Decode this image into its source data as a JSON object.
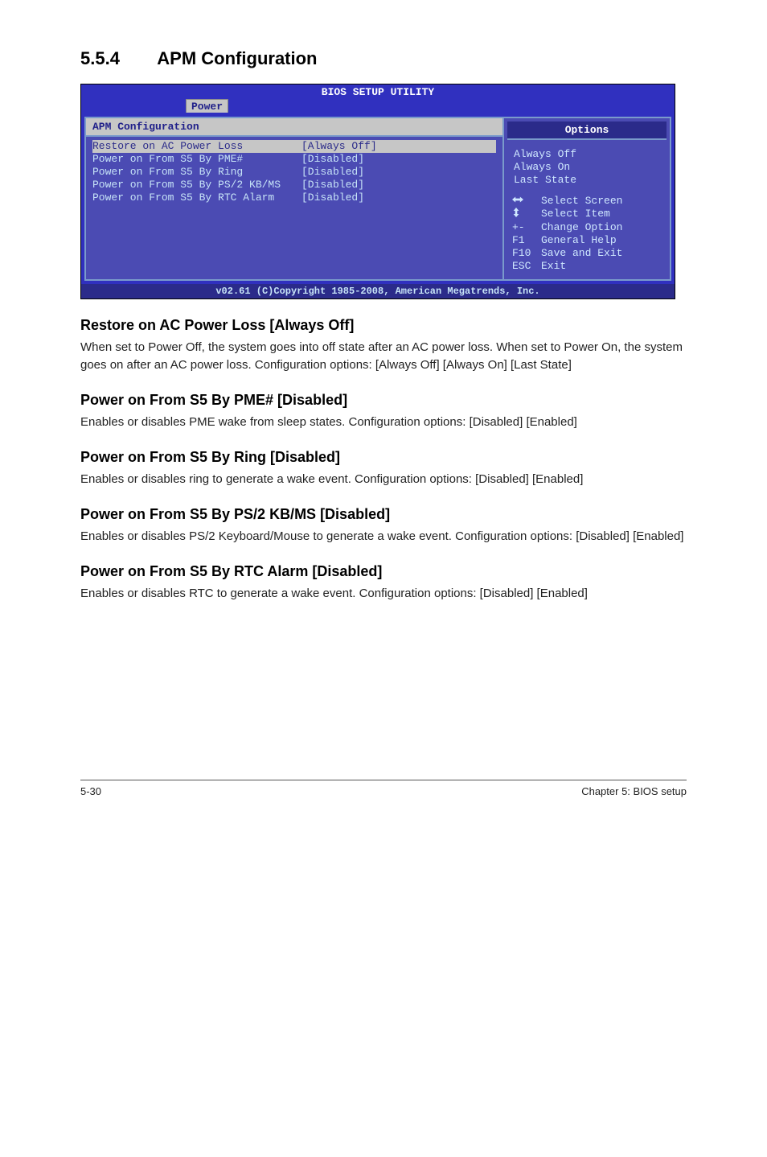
{
  "section": {
    "number": "5.5.4",
    "title": "APM Configuration"
  },
  "bios": {
    "utility_title": "BIOS SETUP UTILITY",
    "tab": "Power",
    "panel_title": "APM Configuration",
    "settings": [
      {
        "label": "Restore on AC Power Loss",
        "value": "[Always Off]",
        "selected": true
      },
      {
        "label": "Power on From S5 By PME#",
        "value": "[Disabled]",
        "selected": false
      },
      {
        "label": "Power on From S5 By Ring",
        "value": "[Disabled]",
        "selected": false
      },
      {
        "label": "Power on From S5 By PS/2 KB/MS",
        "value": "[Disabled]",
        "selected": false
      },
      {
        "label": "Power on From S5 By RTC Alarm",
        "value": "[Disabled]",
        "selected": false
      }
    ],
    "options_header": "Options",
    "options": [
      "Always Off",
      "Always On",
      "Last State"
    ],
    "help": [
      {
        "key": "↔",
        "text": "Select Screen",
        "icon": "lr-arrows-icon"
      },
      {
        "key": "↕",
        "text": "Select Item",
        "icon": "ud-arrows-icon"
      },
      {
        "key": "+-",
        "text": "Change Option",
        "icon": ""
      },
      {
        "key": "F1",
        "text": "General Help",
        "icon": ""
      },
      {
        "key": "F10",
        "text": "Save and Exit",
        "icon": ""
      },
      {
        "key": "ESC",
        "text": "Exit",
        "icon": ""
      }
    ],
    "footer": "v02.61 (C)Copyright 1985-2008, American Megatrends, Inc."
  },
  "doc": {
    "s1_h": "Restore on AC Power Loss [Always Off]",
    "s1_b": "When set to Power Off, the system goes into off state after an AC power loss. When set to Power On, the system goes on after an AC power loss. Configuration options: [Always Off] [Always On] [Last State]",
    "s2_h": "Power on From S5 By PME# [Disabled]",
    "s2_b": "Enables or disables PME wake from sleep states. Configuration options: [Disabled] [Enabled]",
    "s3_h": "Power on From S5 By Ring [Disabled]",
    "s3_b": "Enables or disables ring to generate a wake event. Configuration options: [Disabled] [Enabled]",
    "s4_h": "Power on From S5 By PS/2 KB/MS [Disabled]",
    "s4_b": "Enables or disables PS/2 Keyboard/Mouse to generate a wake event. Configuration options: [Disabled] [Enabled]",
    "s5_h": "Power on From S5 By RTC Alarm [Disabled]",
    "s5_b": "Enables or disables RTC to generate a wake event. Configuration options: [Disabled] [Enabled]"
  },
  "footer": {
    "left": "5-30",
    "right": "Chapter 5: BIOS setup"
  }
}
